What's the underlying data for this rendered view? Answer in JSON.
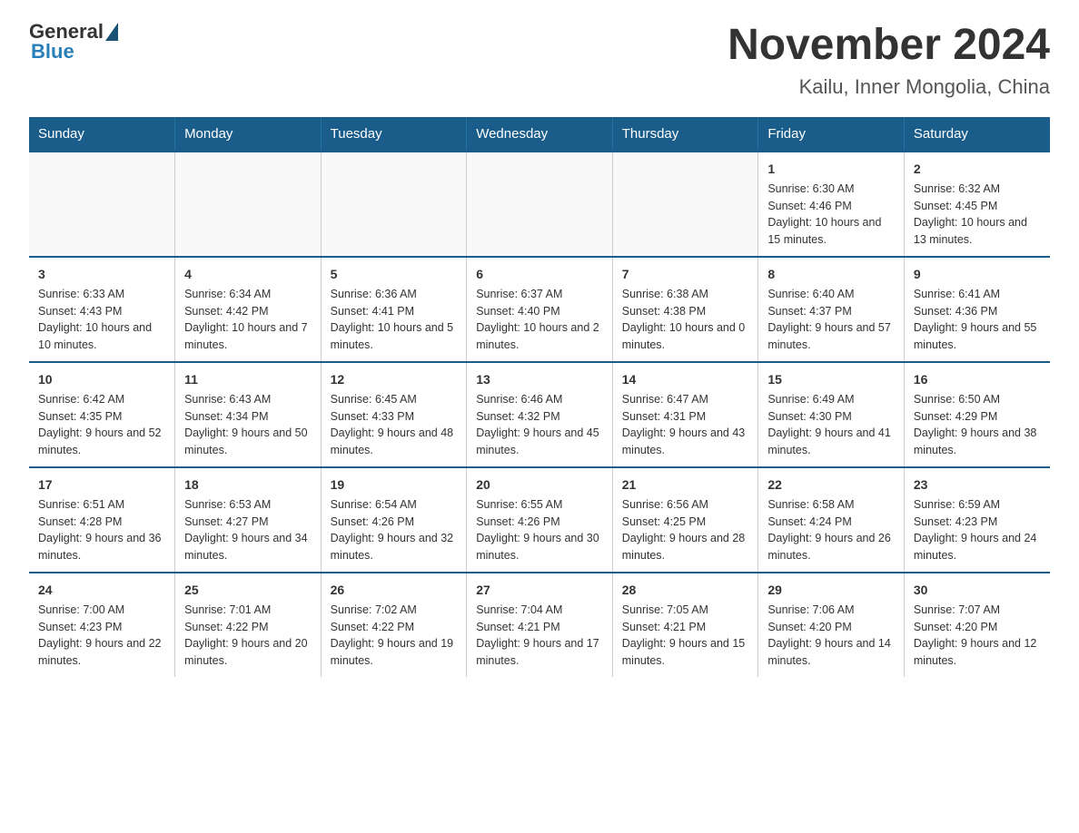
{
  "header": {
    "logo_general": "General",
    "logo_blue": "Blue",
    "title": "November 2024",
    "subtitle": "Kailu, Inner Mongolia, China"
  },
  "days_of_week": [
    "Sunday",
    "Monday",
    "Tuesday",
    "Wednesday",
    "Thursday",
    "Friday",
    "Saturday"
  ],
  "rows": [
    {
      "cells": [
        {
          "day": "",
          "empty": true
        },
        {
          "day": "",
          "empty": true
        },
        {
          "day": "",
          "empty": true
        },
        {
          "day": "",
          "empty": true
        },
        {
          "day": "",
          "empty": true
        },
        {
          "day": "1",
          "sunrise": "Sunrise: 6:30 AM",
          "sunset": "Sunset: 4:46 PM",
          "daylight": "Daylight: 10 hours and 15 minutes."
        },
        {
          "day": "2",
          "sunrise": "Sunrise: 6:32 AM",
          "sunset": "Sunset: 4:45 PM",
          "daylight": "Daylight: 10 hours and 13 minutes."
        }
      ]
    },
    {
      "cells": [
        {
          "day": "3",
          "sunrise": "Sunrise: 6:33 AM",
          "sunset": "Sunset: 4:43 PM",
          "daylight": "Daylight: 10 hours and 10 minutes."
        },
        {
          "day": "4",
          "sunrise": "Sunrise: 6:34 AM",
          "sunset": "Sunset: 4:42 PM",
          "daylight": "Daylight: 10 hours and 7 minutes."
        },
        {
          "day": "5",
          "sunrise": "Sunrise: 6:36 AM",
          "sunset": "Sunset: 4:41 PM",
          "daylight": "Daylight: 10 hours and 5 minutes."
        },
        {
          "day": "6",
          "sunrise": "Sunrise: 6:37 AM",
          "sunset": "Sunset: 4:40 PM",
          "daylight": "Daylight: 10 hours and 2 minutes."
        },
        {
          "day": "7",
          "sunrise": "Sunrise: 6:38 AM",
          "sunset": "Sunset: 4:38 PM",
          "daylight": "Daylight: 10 hours and 0 minutes."
        },
        {
          "day": "8",
          "sunrise": "Sunrise: 6:40 AM",
          "sunset": "Sunset: 4:37 PM",
          "daylight": "Daylight: 9 hours and 57 minutes."
        },
        {
          "day": "9",
          "sunrise": "Sunrise: 6:41 AM",
          "sunset": "Sunset: 4:36 PM",
          "daylight": "Daylight: 9 hours and 55 minutes."
        }
      ]
    },
    {
      "cells": [
        {
          "day": "10",
          "sunrise": "Sunrise: 6:42 AM",
          "sunset": "Sunset: 4:35 PM",
          "daylight": "Daylight: 9 hours and 52 minutes."
        },
        {
          "day": "11",
          "sunrise": "Sunrise: 6:43 AM",
          "sunset": "Sunset: 4:34 PM",
          "daylight": "Daylight: 9 hours and 50 minutes."
        },
        {
          "day": "12",
          "sunrise": "Sunrise: 6:45 AM",
          "sunset": "Sunset: 4:33 PM",
          "daylight": "Daylight: 9 hours and 48 minutes."
        },
        {
          "day": "13",
          "sunrise": "Sunrise: 6:46 AM",
          "sunset": "Sunset: 4:32 PM",
          "daylight": "Daylight: 9 hours and 45 minutes."
        },
        {
          "day": "14",
          "sunrise": "Sunrise: 6:47 AM",
          "sunset": "Sunset: 4:31 PM",
          "daylight": "Daylight: 9 hours and 43 minutes."
        },
        {
          "day": "15",
          "sunrise": "Sunrise: 6:49 AM",
          "sunset": "Sunset: 4:30 PM",
          "daylight": "Daylight: 9 hours and 41 minutes."
        },
        {
          "day": "16",
          "sunrise": "Sunrise: 6:50 AM",
          "sunset": "Sunset: 4:29 PM",
          "daylight": "Daylight: 9 hours and 38 minutes."
        }
      ]
    },
    {
      "cells": [
        {
          "day": "17",
          "sunrise": "Sunrise: 6:51 AM",
          "sunset": "Sunset: 4:28 PM",
          "daylight": "Daylight: 9 hours and 36 minutes."
        },
        {
          "day": "18",
          "sunrise": "Sunrise: 6:53 AM",
          "sunset": "Sunset: 4:27 PM",
          "daylight": "Daylight: 9 hours and 34 minutes."
        },
        {
          "day": "19",
          "sunrise": "Sunrise: 6:54 AM",
          "sunset": "Sunset: 4:26 PM",
          "daylight": "Daylight: 9 hours and 32 minutes."
        },
        {
          "day": "20",
          "sunrise": "Sunrise: 6:55 AM",
          "sunset": "Sunset: 4:26 PM",
          "daylight": "Daylight: 9 hours and 30 minutes."
        },
        {
          "day": "21",
          "sunrise": "Sunrise: 6:56 AM",
          "sunset": "Sunset: 4:25 PM",
          "daylight": "Daylight: 9 hours and 28 minutes."
        },
        {
          "day": "22",
          "sunrise": "Sunrise: 6:58 AM",
          "sunset": "Sunset: 4:24 PM",
          "daylight": "Daylight: 9 hours and 26 minutes."
        },
        {
          "day": "23",
          "sunrise": "Sunrise: 6:59 AM",
          "sunset": "Sunset: 4:23 PM",
          "daylight": "Daylight: 9 hours and 24 minutes."
        }
      ]
    },
    {
      "cells": [
        {
          "day": "24",
          "sunrise": "Sunrise: 7:00 AM",
          "sunset": "Sunset: 4:23 PM",
          "daylight": "Daylight: 9 hours and 22 minutes."
        },
        {
          "day": "25",
          "sunrise": "Sunrise: 7:01 AM",
          "sunset": "Sunset: 4:22 PM",
          "daylight": "Daylight: 9 hours and 20 minutes."
        },
        {
          "day": "26",
          "sunrise": "Sunrise: 7:02 AM",
          "sunset": "Sunset: 4:22 PM",
          "daylight": "Daylight: 9 hours and 19 minutes."
        },
        {
          "day": "27",
          "sunrise": "Sunrise: 7:04 AM",
          "sunset": "Sunset: 4:21 PM",
          "daylight": "Daylight: 9 hours and 17 minutes."
        },
        {
          "day": "28",
          "sunrise": "Sunrise: 7:05 AM",
          "sunset": "Sunset: 4:21 PM",
          "daylight": "Daylight: 9 hours and 15 minutes."
        },
        {
          "day": "29",
          "sunrise": "Sunrise: 7:06 AM",
          "sunset": "Sunset: 4:20 PM",
          "daylight": "Daylight: 9 hours and 14 minutes."
        },
        {
          "day": "30",
          "sunrise": "Sunrise: 7:07 AM",
          "sunset": "Sunset: 4:20 PM",
          "daylight": "Daylight: 9 hours and 12 minutes."
        }
      ]
    }
  ]
}
